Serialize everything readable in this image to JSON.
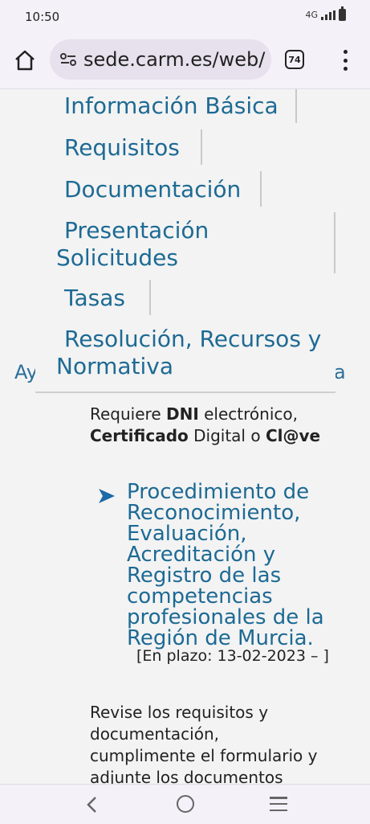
{
  "status": {
    "time": "10:50",
    "network": "4G"
  },
  "browser": {
    "url": "sede.carm.es/web/",
    "tab_count": "74"
  },
  "page": {
    "behind_left": "Ay",
    "behind_right": "a",
    "nav_menu": [
      "Información Básica",
      "Requisitos",
      "Documentación",
      "Presentación",
      "Solicitudes",
      "Tasas",
      "Resolución, Recursos y",
      "Normativa"
    ],
    "requirement": {
      "t1": "Requiere ",
      "b1": "DNI",
      "t2": " electrónico,",
      "b2": "Certificado",
      "t3": " Digital o ",
      "b3": "Cl@ve"
    },
    "procedure": {
      "title": "Procedimiento de Reconocimiento, Evaluación, Acreditación y Registro de las competencias profesionales de la Región de Murcia.",
      "deadline": "[En plazo: 13-02-2023 – ]"
    },
    "instructions": [
      "Revise los requisitos y",
      "documentación,",
      "cumplimente el formulario y",
      "adjunte los documentos"
    ]
  }
}
